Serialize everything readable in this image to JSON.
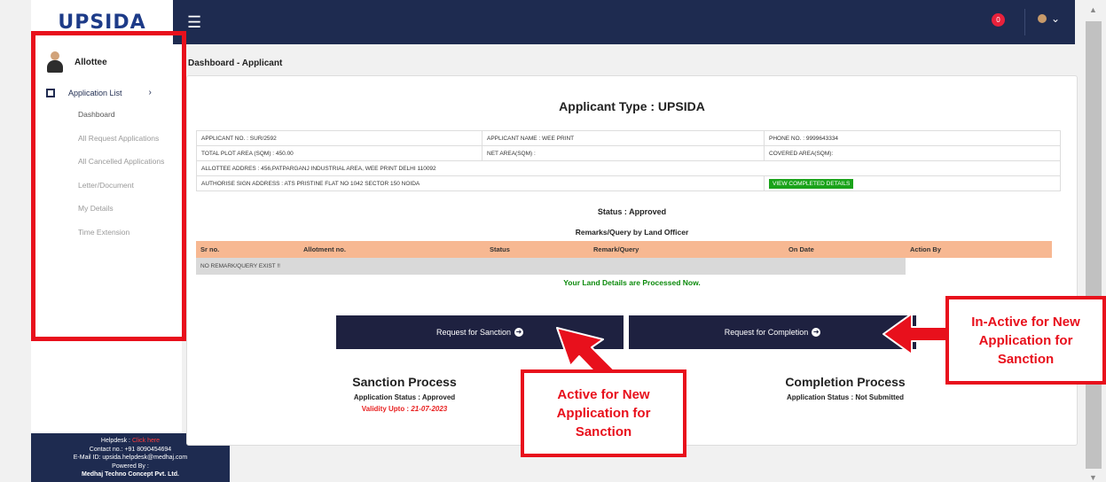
{
  "header": {
    "logo_text": "UPSIDA",
    "menu_icon": "☰",
    "notification_count": "0",
    "user_caret": "⌄"
  },
  "sidebar": {
    "profile_name": "Allottee",
    "menu_title": "Application List",
    "menu_chevron": "›",
    "items": [
      {
        "label": "Dashboard"
      },
      {
        "label": "All Request Applications"
      },
      {
        "label": "All Cancelled Applications"
      },
      {
        "label": "Letter/Document"
      },
      {
        "label": "My Details"
      },
      {
        "label": "Time Extension"
      }
    ]
  },
  "helpdesk": {
    "label": "Helpdesk :",
    "link": "Click here",
    "contact": "Contact no.: +91 8090454694",
    "email": "E-Mail ID: upsida.helpdesk@medhaj.com",
    "powered": "Powered By :",
    "company": "Medhaj Techno Concept Pvt. Ltd."
  },
  "page": {
    "heading": "Dashboard - Applicant",
    "applicant_type": "Applicant Type : UPSIDA"
  },
  "info": {
    "applicant_no": "APPLICANT NO. : SUR/2592",
    "applicant_name": "APPLICANT NAME : WEE PRINT",
    "phone": "PHONE NO. : 9999643334",
    "total_plot_area": "TOTAL PLOT AREA (SQM) : 450.00",
    "net_area": "NET AREA(SQM) :",
    "covered_area": "COVERED AREA(SQM):",
    "allottee_address": "ALLOTTEE ADDRES : 456,PATPARGANJ INDUSTRIAL AREA, WEE PRINT  DELHI 110092",
    "authorise_address": "AUTHORISE SIGN ADDRESS : ATS PRISTINE FLAT NO 1042 SECTOR 150 NOIDA",
    "view_button": "VIEW COMPLETED DETAILS"
  },
  "status": {
    "text": "Status : Approved",
    "remarks_title": "Remarks/Query by Land Officer",
    "processed": "Your Land Details are Processed Now."
  },
  "remarks_table": {
    "columns": [
      "Sr no.",
      "Allotment no.",
      "Status",
      "Remark/Query",
      "On Date",
      "Action By"
    ],
    "empty": "NO REMARK/QUERY EXIST !!"
  },
  "buttons": {
    "sanction": "Request for Sanction",
    "completion": "Request for Completion",
    "arrow": "➜"
  },
  "sanction_process": {
    "title": "Sanction Process",
    "status": "Application Status : Approved",
    "validity_label": "Validity Upto :",
    "validity_date": "21-07-2023"
  },
  "completion_process": {
    "title": "Completion Process",
    "status": "Application Status : Not Submitted"
  },
  "annotations": {
    "active_l1": "Active for New",
    "active_l2": "Application for",
    "active_l3": "Sanction",
    "inactive_l1": "In-Active for New",
    "inactive_l2": "Application for",
    "inactive_l3": "Sanction",
    "color": "#e8101c"
  }
}
